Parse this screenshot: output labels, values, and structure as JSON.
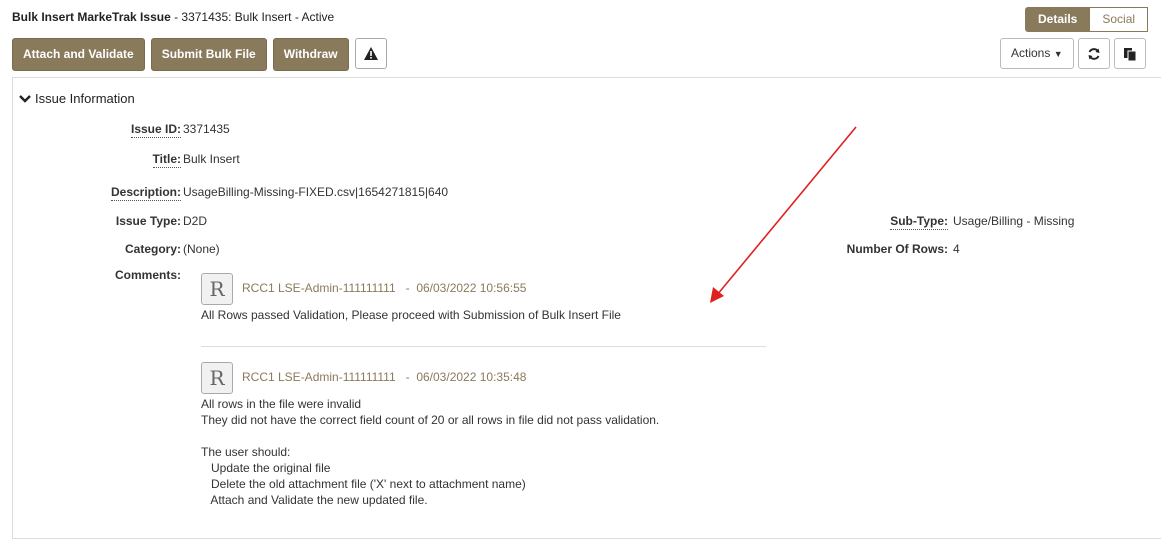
{
  "header": {
    "title_bold": "Bulk Insert MarkeTrak Issue",
    "title_rest": " - 3371435: Bulk Insert - Active",
    "tabs": [
      {
        "label": "Details"
      },
      {
        "label": "Social"
      }
    ]
  },
  "toolbar": {
    "attach_label": "Attach and Validate",
    "submit_label": "Submit Bulk File",
    "withdraw_label": "Withdraw",
    "actions_label": "Actions"
  },
  "section": {
    "title": "Issue Information"
  },
  "fields": {
    "issue_id_label": "Issue ID:",
    "issue_id": "3371435",
    "title_label": "Title:",
    "title": "Bulk Insert",
    "description_label": "Description:",
    "description": "UsageBilling-Missing-FIXED.csv|1654271815|640",
    "issue_type_label": "Issue Type:",
    "issue_type": "D2D",
    "category_label": "Category:",
    "category": "(None)",
    "subtype_label": "Sub-Type:",
    "subtype": "Usage/Billing - Missing",
    "rows_label": "Number Of Rows:",
    "rows": "4",
    "comments_label": "Comments:"
  },
  "comments": [
    {
      "avatar": "R",
      "author": "RCC1 LSE-Admin-111111111",
      "timestamp": "06/03/2022 10:56:55",
      "text": "All Rows passed Validation, Please proceed with Submission of Bulk Insert File"
    },
    {
      "avatar": "R",
      "author": "RCC1 LSE-Admin-111111111",
      "timestamp": "06/03/2022 10:35:48",
      "text": "All rows in the file were invalid\nThey did not have the correct field count of 20 or all rows in file did not pass validation.\n\nThe user should:\n   Update the original file\n   Delete the old attachment file ('X' next to attachment name)\n   Attach and Validate the new updated file."
    }
  ],
  "colors": {
    "accent": "#8a7a5c",
    "annotation_arrow": "#e02020"
  },
  "icons": [
    "warning-icon",
    "dropdown-caret-icon",
    "refresh-icon",
    "copy-icon",
    "chevron-down-icon",
    "avatar-letter"
  ]
}
